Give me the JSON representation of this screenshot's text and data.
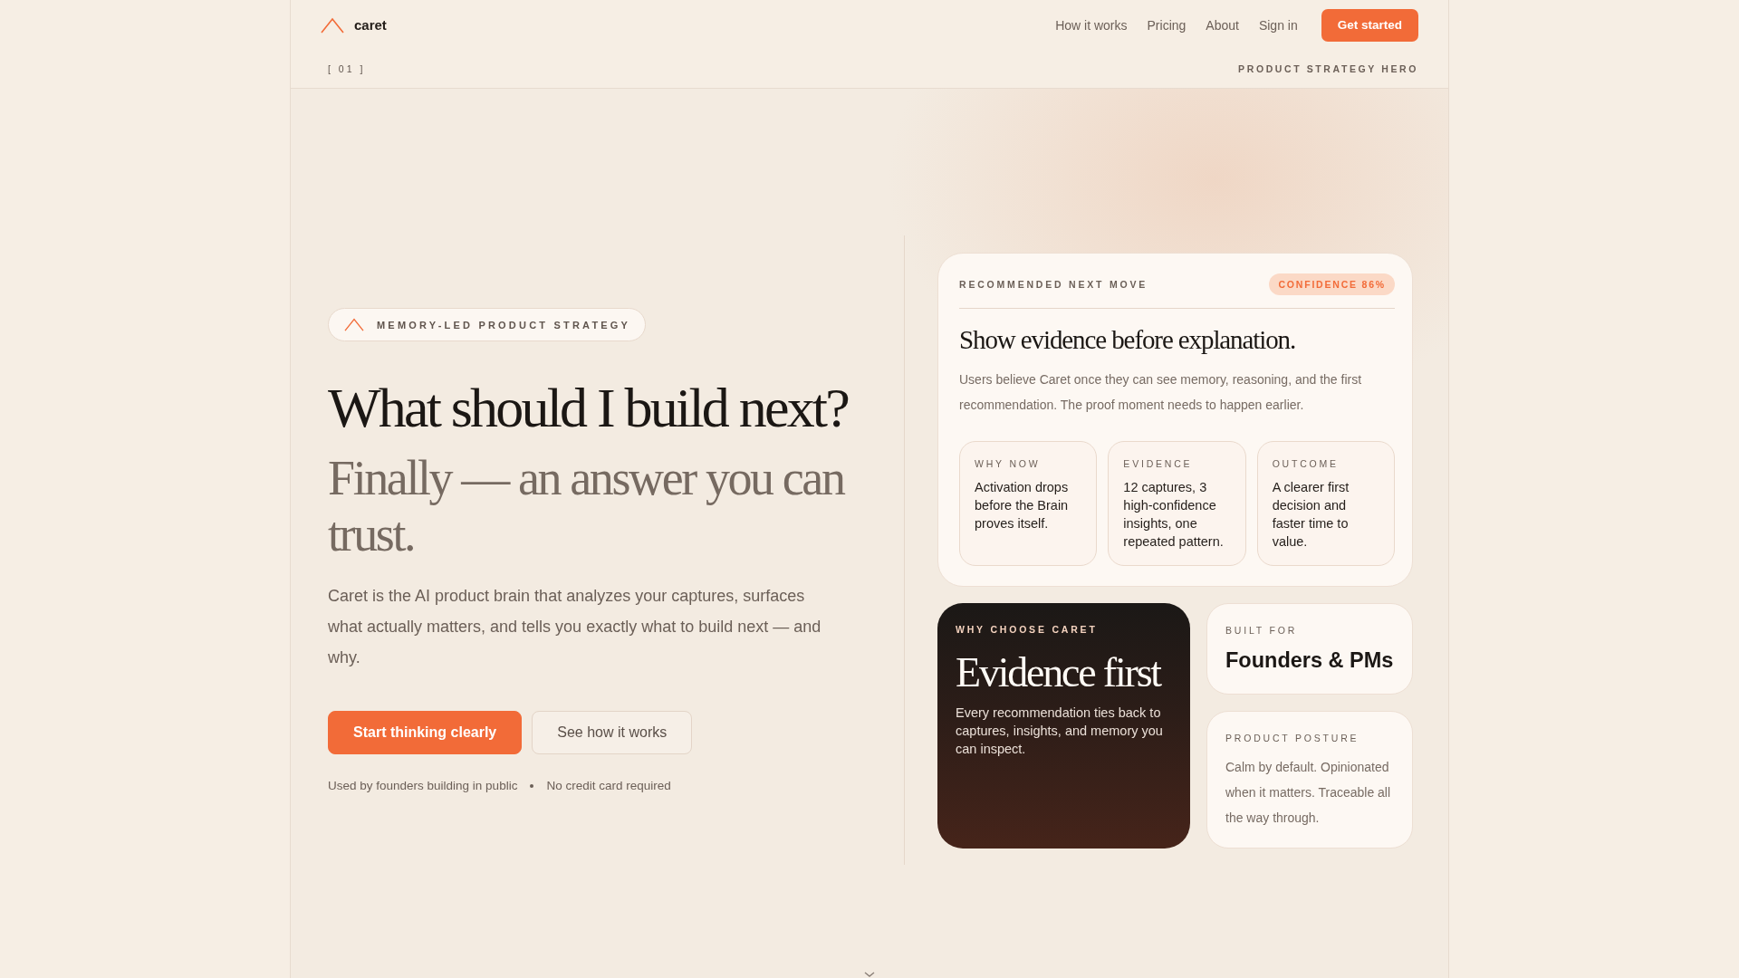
{
  "header": {
    "brand": "caret",
    "nav": [
      "How it works",
      "Pricing",
      "About",
      "Sign in"
    ],
    "cta": "Get started"
  },
  "section_bar": {
    "index": "[ 01 ]",
    "label": "PRODUCT STRATEGY HERO"
  },
  "hero": {
    "badge": "MEMORY-LED PRODUCT STRATEGY",
    "title": "What should I build next?",
    "subtitle": "Finally — an answer you can trust.",
    "description": "Caret is the AI product brain that analyzes your captures, surfaces what actually matters, and tells you exactly what to build next — and why.",
    "buttons": [
      {
        "label": "Start thinking clearly",
        "kind": "primary"
      },
      {
        "label": "See how it works",
        "kind": "secondary"
      }
    ],
    "notes": [
      "Used by founders building in public",
      "No credit card required"
    ]
  },
  "recommendation_card": {
    "eyebrow": "RECOMMENDED NEXT MOVE",
    "confidence": "CONFIDENCE 86%",
    "title": "Show evidence before explanation.",
    "body": "Users believe Caret once they can see memory, reasoning, and the first recommendation. The proof moment needs to happen earlier.",
    "facts": [
      {
        "label": "WHY NOW",
        "text": "Activation drops before the Brain proves itself."
      },
      {
        "label": "EVIDENCE",
        "text": "12 captures, 3 high-confidence insights, one repeated pattern."
      },
      {
        "label": "OUTCOME",
        "text": "A clearer first decision and faster time to value."
      }
    ]
  },
  "feature_cards": [
    {
      "kind": "dark",
      "eyebrow": "WHY CHOOSE CARET",
      "title": "Evidence first",
      "body": "Every recommendation ties back to captures, insights, and memory you can inspect."
    },
    {
      "kind": "headline",
      "eyebrow": "BUILT FOR",
      "title": "Founders & PMs"
    },
    {
      "kind": "note",
      "eyebrow": "PRODUCT POSTURE",
      "body": "Calm by default. Opinionated when it matters. Traceable all the way through."
    }
  ]
}
